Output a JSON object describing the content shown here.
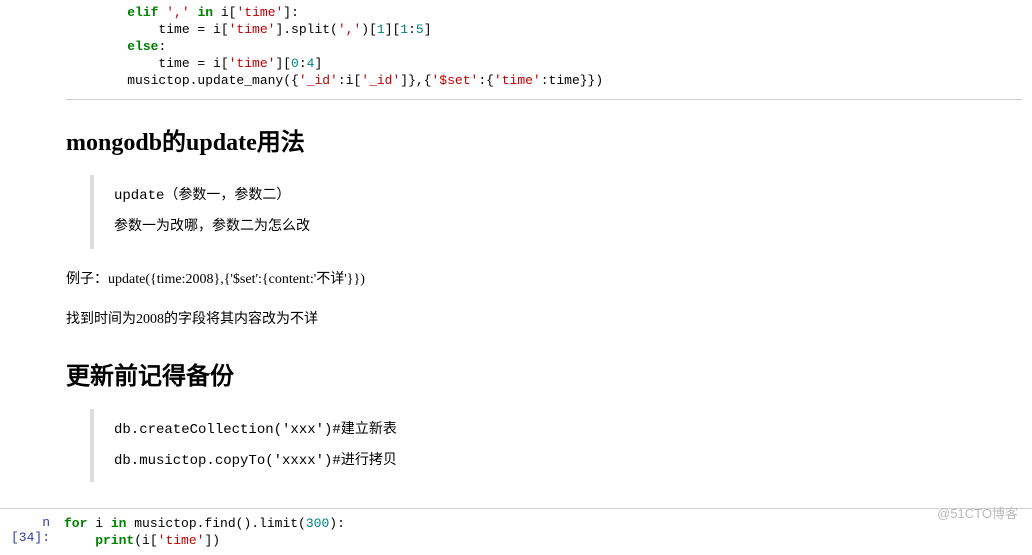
{
  "codeTop": {
    "tokens": [
      {
        "cls": "plain",
        "t": "    "
      },
      {
        "cls": "k-green",
        "t": "elif"
      },
      {
        "cls": "plain",
        "t": " "
      },
      {
        "cls": "k-red",
        "t": "','"
      },
      {
        "cls": "plain",
        "t": " "
      },
      {
        "cls": "k-green",
        "t": "in"
      },
      {
        "cls": "plain",
        "t": " i["
      },
      {
        "cls": "k-red",
        "t": "'time'"
      },
      {
        "cls": "plain",
        "t": "]:"
      },
      {
        "cls": "nl",
        "t": "\n"
      },
      {
        "cls": "plain",
        "t": "        time = i["
      },
      {
        "cls": "k-red",
        "t": "'time'"
      },
      {
        "cls": "plain",
        "t": "].split("
      },
      {
        "cls": "k-red",
        "t": "','"
      },
      {
        "cls": "plain",
        "t": ")["
      },
      {
        "cls": "k-teal",
        "t": "1"
      },
      {
        "cls": "plain",
        "t": "]["
      },
      {
        "cls": "k-teal",
        "t": "1"
      },
      {
        "cls": "plain",
        "t": ":"
      },
      {
        "cls": "k-teal",
        "t": "5"
      },
      {
        "cls": "plain",
        "t": "]"
      },
      {
        "cls": "nl",
        "t": "\n"
      },
      {
        "cls": "plain",
        "t": "    "
      },
      {
        "cls": "k-green",
        "t": "else"
      },
      {
        "cls": "plain",
        "t": ":"
      },
      {
        "cls": "nl",
        "t": "\n"
      },
      {
        "cls": "plain",
        "t": "        time = i["
      },
      {
        "cls": "k-red",
        "t": "'time'"
      },
      {
        "cls": "plain",
        "t": "]["
      },
      {
        "cls": "k-teal",
        "t": "0"
      },
      {
        "cls": "plain",
        "t": ":"
      },
      {
        "cls": "k-teal",
        "t": "4"
      },
      {
        "cls": "plain",
        "t": "]"
      },
      {
        "cls": "nl",
        "t": "\n"
      },
      {
        "cls": "plain",
        "t": "    musictop.update_many({"
      },
      {
        "cls": "k-red",
        "t": "'_id'"
      },
      {
        "cls": "plain",
        "t": ":i["
      },
      {
        "cls": "k-red",
        "t": "'_id'"
      },
      {
        "cls": "plain",
        "t": "]},{"
      },
      {
        "cls": "k-red",
        "t": "'$set'"
      },
      {
        "cls": "plain",
        "t": ":{"
      },
      {
        "cls": "k-red",
        "t": "'time'"
      },
      {
        "cls": "plain",
        "t": ":time}})"
      }
    ]
  },
  "heading1": "mongodb的update用法",
  "quote1": {
    "line1": "update（参数一，参数二）",
    "line2": "参数一为改哪，参数二为怎么改"
  },
  "para1": "例子：update({time:2008},{'$set':{content:'不详'}})",
  "para2": "找到时间为2008的字段将其内容改为不详",
  "heading2": "更新前记得备份",
  "quote2": {
    "line1": "db.createCollection('xxx')#建立新表",
    "line2": "db.musictop.copyTo('xxxx')#进行拷贝"
  },
  "cell": {
    "prompt": "n [34]:",
    "tokens": [
      {
        "cls": "k-green",
        "t": "for"
      },
      {
        "cls": "plain",
        "t": " i "
      },
      {
        "cls": "k-green",
        "t": "in"
      },
      {
        "cls": "plain",
        "t": " musictop.find().limit("
      },
      {
        "cls": "k-teal",
        "t": "300"
      },
      {
        "cls": "plain",
        "t": "):"
      },
      {
        "cls": "nl",
        "t": "\n"
      },
      {
        "cls": "plain",
        "t": "    "
      },
      {
        "cls": "k-green",
        "t": "print"
      },
      {
        "cls": "plain",
        "t": "(i["
      },
      {
        "cls": "k-red",
        "t": "'time'"
      },
      {
        "cls": "plain",
        "t": "])"
      }
    ]
  },
  "watermark": "@51CTO博客"
}
